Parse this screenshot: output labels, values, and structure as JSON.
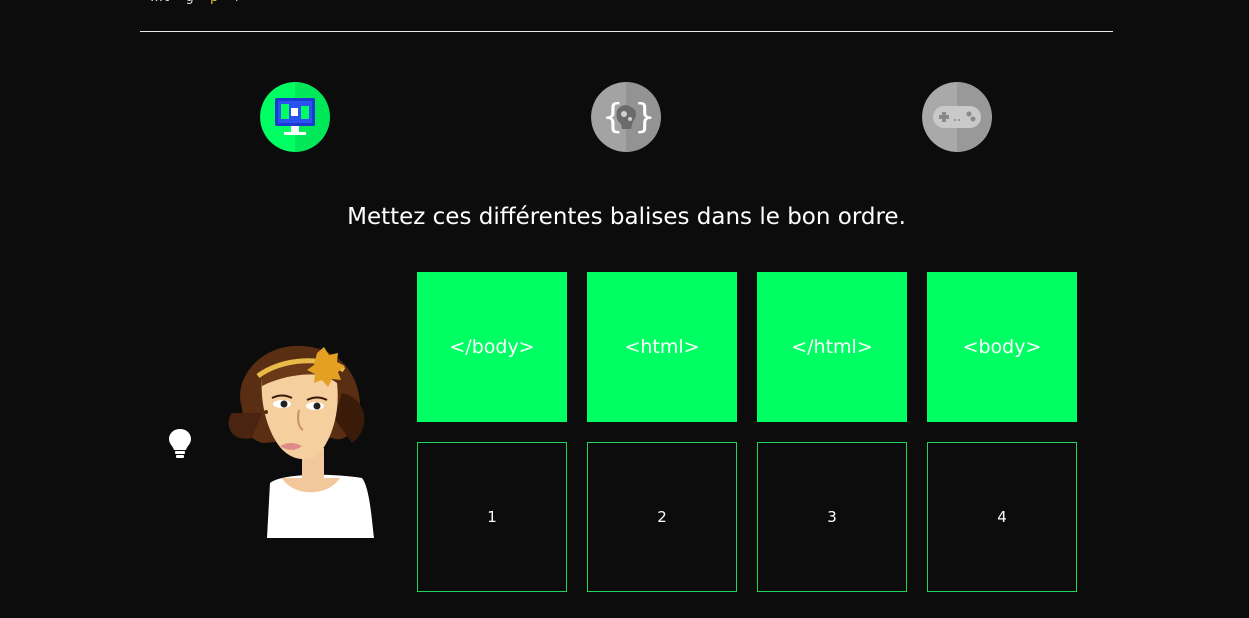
{
  "header": {
    "clipped_text": "…t · g · p · i ·",
    "clipped_accent": "p"
  },
  "steps": [
    {
      "icon": "computer-screen-icon",
      "state": "active",
      "color": "#00ff62"
    },
    {
      "icon": "code-brain-icon",
      "state": "inactive",
      "color": "#9a9a9a"
    },
    {
      "icon": "gamepad-icon",
      "state": "inactive",
      "color": "#9a9a9a"
    }
  ],
  "exercise": {
    "instruction": "Mettez ces différentes balises dans le bon ordre.",
    "tags": [
      "</body>",
      "<html>",
      "</html>",
      "<body>"
    ],
    "slots": [
      "1",
      "2",
      "3",
      "4"
    ]
  },
  "colors": {
    "accent": "#00ff62",
    "background": "#0c0c0c",
    "slot_border": "#1fd45a"
  }
}
